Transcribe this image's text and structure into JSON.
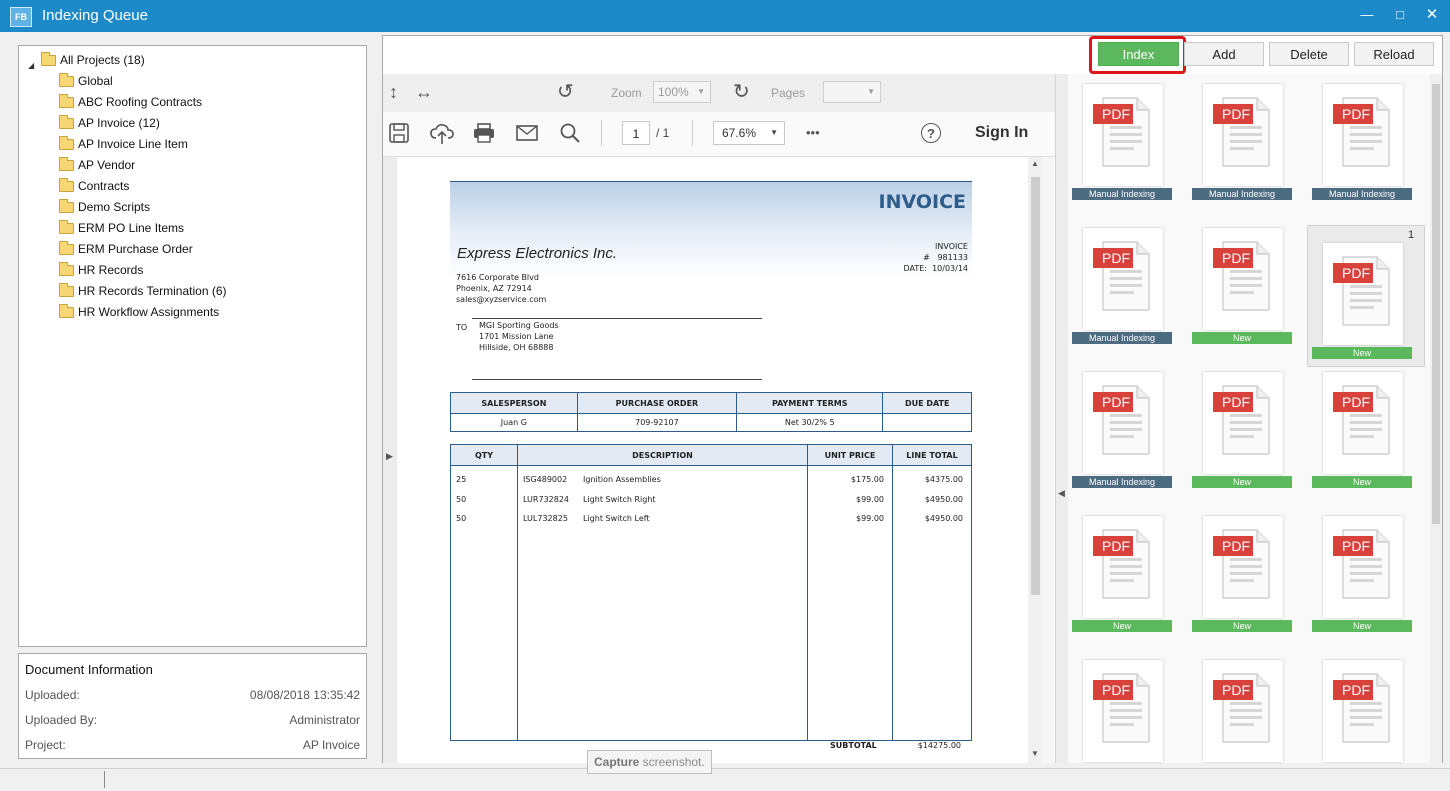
{
  "window": {
    "title": "Indexing Queue",
    "app_icon": "FB"
  },
  "tree": {
    "root": "All Projects (18)",
    "items": [
      "Global",
      "ABC Roofing Contracts",
      "AP Invoice (12)",
      "AP Invoice Line Item",
      "AP Vendor",
      "Contracts",
      "Demo Scripts",
      "ERM PO Line Items",
      "ERM Purchase Order",
      "HR Records",
      "HR Records Termination (6)",
      "HR Workflow Assignments"
    ]
  },
  "docinfo": {
    "title": "Document Information",
    "rows": [
      {
        "label": "Uploaded:",
        "value": "08/08/2018 13:35:42"
      },
      {
        "label": "Uploaded By:",
        "value": "Administrator"
      },
      {
        "label": "Project:",
        "value": "AP Invoice"
      }
    ]
  },
  "toolbar": {
    "index": "Index",
    "add": "Add",
    "delete": "Delete",
    "reload": "Reload"
  },
  "viewer": {
    "zoom_label": "Zoom",
    "zoom_value": "100%",
    "pages_label": "Pages",
    "pages_value": "",
    "page_current": "1",
    "page_total": "/  1",
    "zoom_percent": "67.6%",
    "more": "•••",
    "help": "?",
    "sign_in": "Sign In"
  },
  "invoice": {
    "title": "INVOICE",
    "company": "Express Electronics Inc.",
    "invoice_no_label": "INVOICE #",
    "invoice_no": "981133",
    "date_label": "DATE:",
    "date": "10/03/14",
    "address": [
      "7616 Corporate Blvd",
      "Phoenix, AZ 72914",
      "sales@xyzservice.com"
    ],
    "to_label": "TO",
    "to": [
      "MGI Sporting Goods",
      "1701 Mission Lane",
      "Hillside, OH 68888"
    ],
    "info_headers": [
      "SALESPERSON",
      "PURCHASE ORDER",
      "PAYMENT TERMS",
      "DUE DATE"
    ],
    "info_values": [
      "Juan G",
      "709-92107",
      "Net 30/2% 5",
      ""
    ],
    "line_headers": [
      "QTY",
      "DESCRIPTION",
      "UNIT PRICE",
      "LINE TOTAL"
    ],
    "lines": [
      {
        "qty": "25",
        "code": "ISG489002",
        "desc": "Ignition Assemblies",
        "price": "$175.00",
        "total": "$4375.00"
      },
      {
        "qty": "50",
        "code": "LUR732824",
        "desc": "Light Switch Right",
        "price": "$99.00",
        "total": "$4950.00"
      },
      {
        "qty": "50",
        "code": "LUL732825",
        "desc": "Light Switch Left",
        "price": "$99.00",
        "total": "$4950.00"
      }
    ],
    "subtotal_label": "SUBTOTAL",
    "subtotal": "$14275.00"
  },
  "thumbnails": [
    {
      "label": "PDF",
      "status": "Manual Indexing",
      "type": "manual"
    },
    {
      "label": "PDF",
      "status": "Manual Indexing",
      "type": "manual"
    },
    {
      "label": "PDF",
      "status": "Manual Indexing",
      "type": "manual"
    },
    {
      "label": "PDF",
      "status": "Manual Indexing",
      "type": "manual"
    },
    {
      "label": "PDF",
      "status": "New",
      "type": "new"
    },
    {
      "label": "PDF",
      "status": "New",
      "type": "new",
      "selected": true,
      "number": "1"
    },
    {
      "label": "PDF",
      "status": "Manual Indexing",
      "type": "manual"
    },
    {
      "label": "PDF",
      "status": "New",
      "type": "new"
    },
    {
      "label": "PDF",
      "status": "New",
      "type": "new"
    },
    {
      "label": "PDF",
      "status": "New",
      "type": "new"
    },
    {
      "label": "PDF",
      "status": "New",
      "type": "new"
    },
    {
      "label": "PDF",
      "status": "New",
      "type": "new"
    },
    {
      "label": "PDF",
      "status": "",
      "type": "none"
    },
    {
      "label": "PDF",
      "status": "",
      "type": "none"
    },
    {
      "label": "PDF",
      "status": "",
      "type": "none"
    }
  ],
  "tooltip": {
    "bold": "Capture",
    "rest": " screenshot."
  },
  "colors": {
    "titlebar": "#1c8ac9",
    "index_button": "#5cb85c",
    "highlight": "#e0141b",
    "manual_badge": "#4d6b80",
    "new_badge": "#5cb85c",
    "pdf_red": "#d9413b"
  }
}
